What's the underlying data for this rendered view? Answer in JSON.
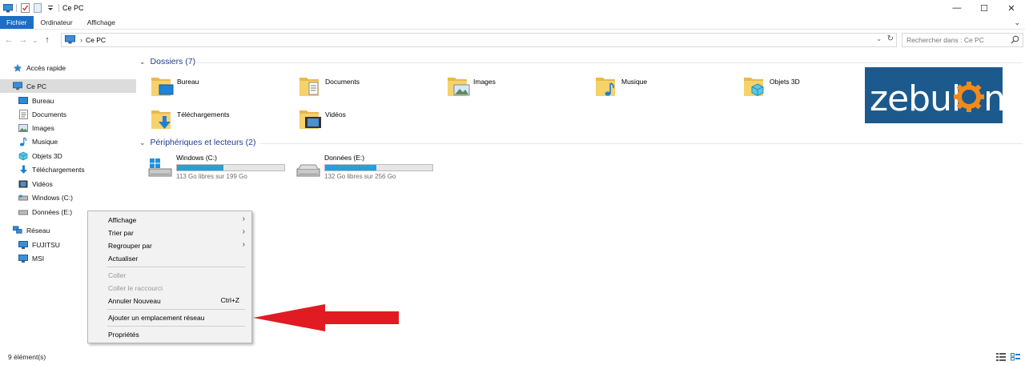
{
  "window": {
    "title": "Ce PC",
    "controls": {
      "minimize": "—",
      "maximize": "☐",
      "close": "✕"
    }
  },
  "ribbon": {
    "tabs": [
      {
        "label": "Fichier",
        "active": true
      },
      {
        "label": "Ordinateur"
      },
      {
        "label": "Affichage"
      }
    ],
    "right_glyph": "⌄"
  },
  "navigation": {
    "back": "←",
    "forward": "→",
    "recent": "⌄",
    "up": "↑",
    "address": {
      "root_sep": "›",
      "location": "Ce PC"
    },
    "dropdown": "⌄",
    "refresh": "↻",
    "search": {
      "placeholder": "Rechercher dans : Ce PC"
    }
  },
  "sidebar": {
    "items": [
      {
        "label": "Accès rapide",
        "icon": "star-icon"
      },
      {
        "label": "Ce PC",
        "icon": "computer-icon",
        "selected": true
      },
      {
        "label": "Bureau",
        "icon": "desktop-icon"
      },
      {
        "label": "Documents",
        "icon": "documents-icon"
      },
      {
        "label": "Images",
        "icon": "pictures-icon"
      },
      {
        "label": "Musique",
        "icon": "music-icon"
      },
      {
        "label": "Objets 3D",
        "icon": "cube-icon"
      },
      {
        "label": "Téléchargements",
        "icon": "download-icon"
      },
      {
        "label": "Vidéos",
        "icon": "video-icon"
      },
      {
        "label": "Windows (C:)",
        "icon": "drive-icon"
      },
      {
        "label": "Données (E:)",
        "icon": "drive-icon"
      },
      {
        "label": "Réseau",
        "icon": "network-icon"
      },
      {
        "label": "FUJITSU",
        "icon": "computer-icon"
      },
      {
        "label": "MSI",
        "icon": "computer-icon"
      }
    ]
  },
  "main": {
    "folders_section": {
      "chevron": "⌄",
      "title": "Dossiers (7)"
    },
    "folders": [
      {
        "label": "Bureau"
      },
      {
        "label": "Documents"
      },
      {
        "label": "Images"
      },
      {
        "label": "Musique"
      },
      {
        "label": "Objets 3D"
      },
      {
        "label": "Téléchargements"
      },
      {
        "label": "Vidéos"
      }
    ],
    "drives_section": {
      "chevron": "⌄",
      "title": "Périphériques et lecteurs (2)"
    },
    "drives": [
      {
        "name": "Windows (C:)",
        "free_text": "113 Go libres sur 199 Go",
        "used_fraction": 0.43
      },
      {
        "name": "Données (E:)",
        "free_text": "132 Go libres sur 256 Go",
        "used_fraction": 0.48
      }
    ]
  },
  "logo": {
    "text": "zebulon",
    "colors": {
      "background": "#1c5a8e",
      "gear": "#f08a1c"
    }
  },
  "context_menu": {
    "items": [
      {
        "label": "Affichage",
        "submenu": true
      },
      {
        "label": "Trier par",
        "submenu": true
      },
      {
        "label": "Regrouper par",
        "submenu": true
      },
      {
        "label": "Actualiser"
      },
      {
        "label": "Coller",
        "disabled": true
      },
      {
        "label": "Coller le raccourci",
        "disabled": true
      },
      {
        "label": "Annuler Nouveau",
        "shortcut": "Ctrl+Z"
      },
      {
        "label": "Ajouter un emplacement réseau"
      },
      {
        "label": "Propriétés"
      }
    ],
    "submenu_glyph": "›"
  },
  "status_bar": {
    "count": "9 élément(s)"
  },
  "colors": {
    "accent": "#1a6fc4",
    "section_title": "#1e3d8f",
    "drive_bar": "#26a0da",
    "arrow": "#e11b22"
  }
}
